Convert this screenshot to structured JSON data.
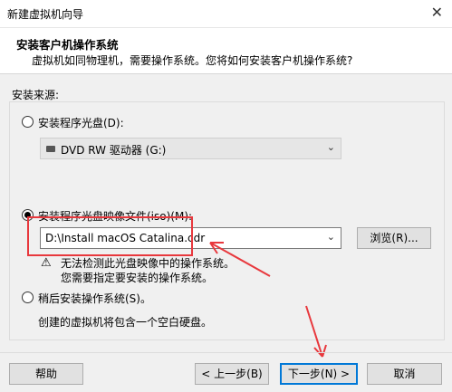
{
  "window": {
    "title": "新建虚拟机向导"
  },
  "header": {
    "title": "安装客户机操作系统",
    "subtitle": "虚拟机如同物理机，需要操作系统。您将如何安装客户机操作系统?"
  },
  "source": {
    "label": "安装来源:",
    "disc_option": "安装程序光盘(D):",
    "disc_drive": "DVD RW 驱动器 (G:)",
    "iso_option": "安装程序光盘映像文件(iso)(M):",
    "iso_path": "D:\\Install macOS Catalina.cdr",
    "browse_label": "浏览(R)...",
    "warning_line1": "无法检测此光盘映像中的操作系统。",
    "warning_line2": "您需要指定要安装的操作系统。",
    "later_option": "稍后安装操作系统(S)。",
    "later_desc": "创建的虚拟机将包含一个空白硬盘。"
  },
  "footer": {
    "help": "帮助",
    "back": "< 上一步(B)",
    "next": "下一步(N) >",
    "cancel": "取消"
  },
  "colors": {
    "annotation": "#e8383d",
    "primary_border": "#0078d7"
  }
}
